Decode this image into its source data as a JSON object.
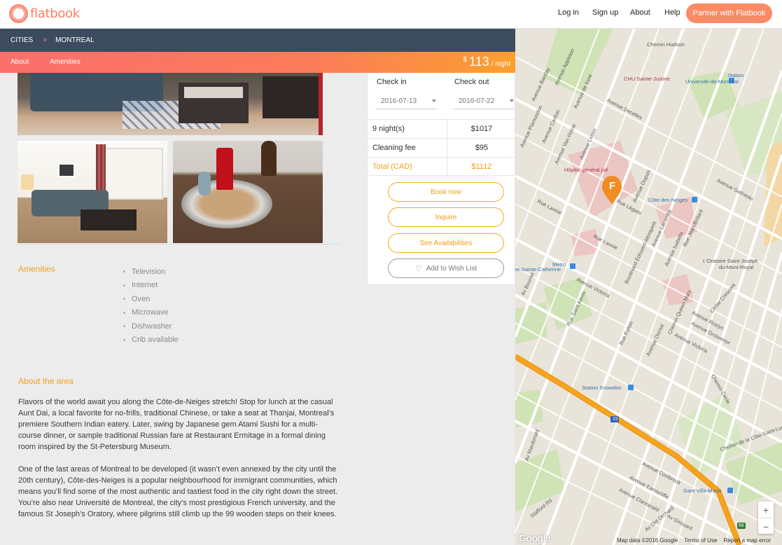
{
  "brand": {
    "name": "flatbook"
  },
  "nav": {
    "login": "Log in",
    "signup": "Sign up",
    "about": "About",
    "help": "Help",
    "partner": "Partner with Flatbook"
  },
  "breadcrumb": {
    "root": "CITIES",
    "separator": ">",
    "current": "MONTREAL"
  },
  "tabs": {
    "about": "About",
    "amenities": "Amenities"
  },
  "price": {
    "currency": "$",
    "amount": "113",
    "unit": "/ night"
  },
  "booking": {
    "checkin_label": "Check in",
    "checkout_label": "Check out",
    "checkin_value": "2016-07-13",
    "checkout_value": "2016-07-22",
    "rows": [
      {
        "label": "9 night(s)",
        "value": "$1017"
      },
      {
        "label": "Cleaning fee",
        "value": "$95"
      },
      {
        "label": "Total (CAD)",
        "value": "$1112"
      }
    ],
    "book_now": "Book now",
    "inquire": "Inquire",
    "availabilities": "See Availabilities",
    "wishlist": "Add to Wish List"
  },
  "amenities": {
    "title": "Amenities",
    "items": [
      "Television",
      "Internet",
      "Oven",
      "Microwave",
      "Dishwasher",
      "Crib available"
    ]
  },
  "about_area": {
    "title": "About the area",
    "paragraphs": [
      "Flavors of the world await you along the Côte-de-Neiges stretch! Stop for lunch at the casual Aunt Dai, a local favorite for no-frills, traditional Chinese, or take a seat at Thanjai, Montreal’s premiere Southern Indian eatery. Later, swing by Japanese gem Atami Sushi for a multi-course dinner, or sample traditional Russian fare at Restaurant Ermitage in a formal dining room inspired by the St-Petersburg Museum.",
      "One of the last areas of Montreal to be developed (it wasn’t even annexed by the city until the 20th century), Côte-des-Neiges is a popular neighbourhood for immigrant communities, which means you’ll find some of the most authentic and tastiest food in the city right down the street. You’re also near Université de Montreal, the city’s most prestigious French university, and the famous St Joseph’s Oratory, where pilgrims still climb up the 99 wooden steps on their knees."
    ]
  },
  "map": {
    "labels": {
      "chemin_hudson": "Chemin Hudson",
      "station_udem": "Station",
      "udem": "Université-de-Montréal",
      "chu": "CHU Sainte-Justine",
      "decelles": "Avenue Decelles",
      "barclay": "Avenue Barclay",
      "appleton": "Avenue Appleton",
      "kent": "Avenue de Kent",
      "plamondon": "Avenue Plamondon",
      "carlton": "Avenue Carlton",
      "van_horne": "Avenue Van Horne",
      "linton": "Avenue Linton",
      "hopital": "Hôpital général juif",
      "dupuis": "Avenue Dupuis",
      "legare": "Rue Légare",
      "lavoie": "Rue Lavoie",
      "cdn_station": "Côte-des-Neiges",
      "gatineau": "Avenue Gatineau",
      "lacombe": "Avenue Lacombe",
      "jean_brillant": "Rue Jean-Brillant",
      "bem": "Boulevard Édouard-Montpetit",
      "isabella": "Avenue Isabella",
      "oratoire1": "L'Oratoire Saint-Joseph",
      "oratoire2": "du-Mont-Royal",
      "metro": "Metro",
      "ste_catherine": "te-Sainte-Catherine",
      "victoria": "Avenue Victoria",
      "st_kevin": "Rue Saint Kevin",
      "fulton": "Rue Fulton",
      "dornal": "Avenue Dornal",
      "queen_mary": "Chemin Queen Mary",
      "cedar": "Cedar Crescent",
      "roslyn": "Avenue Roslyn",
      "grosvenor": "Avenue Grosvenor",
      "snowdon": "Station Snowdon",
      "circle": "Chemin Circle",
      "cote_st_luc": "Chemin de la Côte-Saint-Luc",
      "coolbrook": "Avenue Coolbrook",
      "earnscliffe": "Avenue Earnscliffe",
      "clanranald": "Avenue Clanranald",
      "gare_villa": "Gare Villa-Maria",
      "old_orchard": "Av Old Orchard",
      "girouard": "Av Girouard",
      "macdonald": "Av Macdonald",
      "stafford": "Stafford Rd",
      "mcmahon": "Av Bourret",
      "route15": "15",
      "route66": "66",
      "pin_letter": "F"
    },
    "footer": {
      "data": "Map data ©2016 Google",
      "terms": "Terms of Use",
      "report": "Report a map error"
    },
    "google": "Google",
    "zoom_in": "+",
    "zoom_out": "−"
  },
  "colors": {
    "accent": "#f6a01b",
    "brand": "#fa7e63",
    "header": "#3d4b5f"
  }
}
